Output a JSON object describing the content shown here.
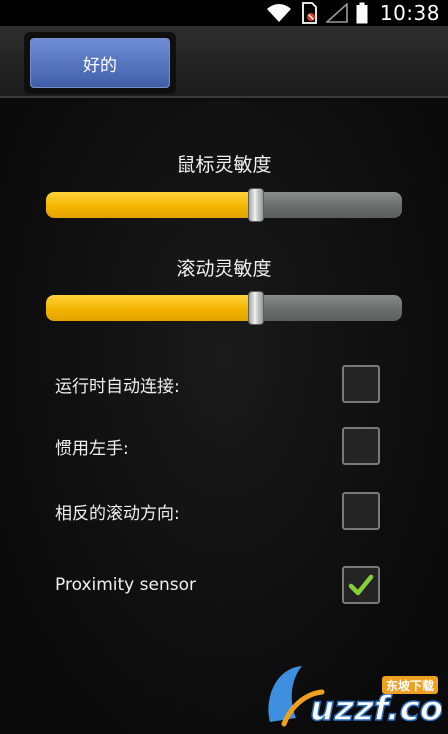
{
  "status_bar": {
    "time": "10:38",
    "icons": [
      "wifi-icon",
      "no-sim-icon",
      "signal-icon",
      "battery-icon"
    ]
  },
  "action_bar": {
    "ok_label": "好的"
  },
  "sliders": [
    {
      "label": "鼠标灵敏度",
      "value": 0.59
    },
    {
      "label": "滚动灵敏度",
      "value": 0.59
    }
  ],
  "options": [
    {
      "label": "运行时自动连接:",
      "checked": false
    },
    {
      "label": "惯用左手:",
      "checked": false
    },
    {
      "label": "相反的滚动方向:",
      "checked": false
    },
    {
      "label": "Proximity sensor",
      "checked": true
    }
  ],
  "watermark": {
    "text": "uzzf.com",
    "subtext": "东坡下载"
  },
  "colors": {
    "slider_fill": "#f3b400",
    "button": "#5677c2",
    "check": "#86d13b"
  }
}
